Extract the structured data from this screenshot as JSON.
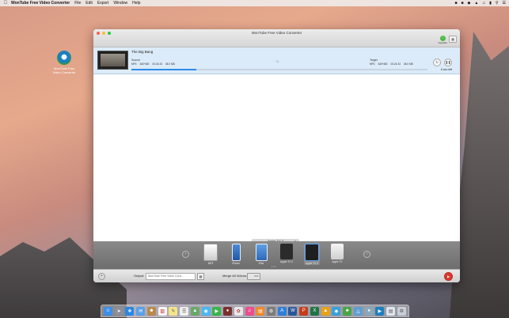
{
  "menubar": {
    "app_name": "WonTube Free Video Converter",
    "menus": [
      "File",
      "Edit",
      "Export",
      "Window",
      "Help"
    ]
  },
  "desktop": {
    "icon_label": "WonTube Free Video Converter"
  },
  "window": {
    "title": "WonTube Free Video Converter",
    "upgrade_label": "Upgrade"
  },
  "item": {
    "title": "The Big Bang",
    "source_label": "Source",
    "target_label": "Target",
    "source": {
      "format": "MP4",
      "resolution": "640*480",
      "duration": "00:24:33",
      "size": "38.0 MB"
    },
    "target": {
      "format": "MP4",
      "resolution": "640*480",
      "duration": "00:24:33",
      "size": "38.0 MB"
    },
    "progress_fraction": 0.22,
    "time_left": "6 sec left"
  },
  "device_panel": {
    "tab_label": "Apple TV 3",
    "devices": [
      {
        "label": "MP3",
        "selected": false
      },
      {
        "label": "iPhone",
        "selected": false
      },
      {
        "label": "iPad",
        "selected": false
      },
      {
        "label": "Apple TV 2",
        "selected": false
      },
      {
        "label": "Apple TV 3",
        "selected": true
      },
      {
        "label": "Apple TV",
        "selected": false
      }
    ]
  },
  "footer": {
    "output_label": "Output:",
    "output_path": "WonTube Free Video Conv...",
    "merge_label": "Merge All Videos:",
    "merge_state": "OFF"
  },
  "colors": {
    "accent": "#2f8ae6",
    "convert": "#e03a30",
    "upgrade": "#4db84a",
    "row_bg": "#dcebf9"
  }
}
